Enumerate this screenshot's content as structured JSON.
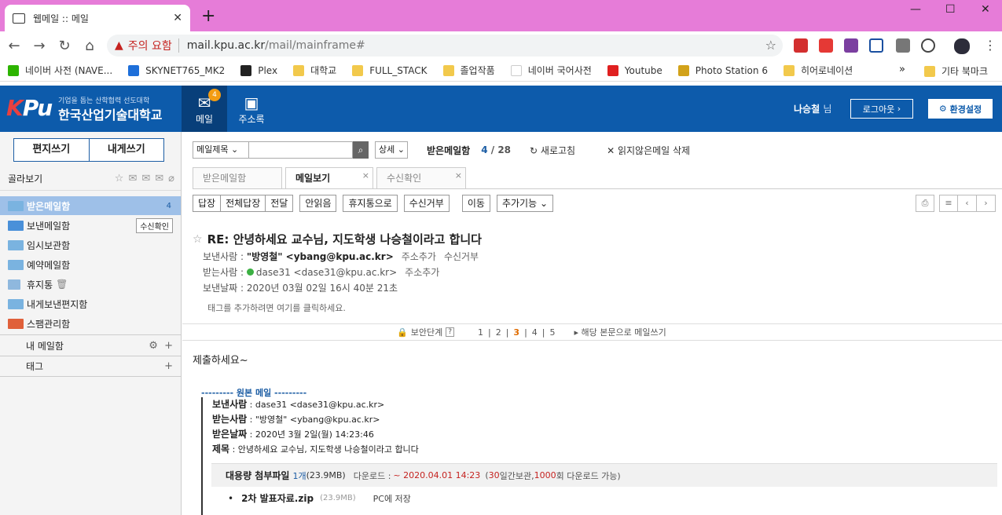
{
  "browser": {
    "tab_title": "웹메일 :: 메일",
    "warning_text": "주의 요함",
    "url_host": "mail.kpu.ac.kr",
    "url_path": "/mail/mainframe#",
    "bookmarks": [
      "네이버 사전 (NAVE...",
      "SKYNET765_MK2",
      "Plex",
      "대학교",
      "FULL_STACK",
      "졸업작품",
      "네이버 국어사전",
      "Youtube",
      "Photo Station 6",
      "히어로네이션"
    ],
    "other_bookmarks": "기타 북마크"
  },
  "app": {
    "logo_text": "KPU",
    "logo_subtitle": "기업을 돕는 산학협력 선도대학",
    "logo_name": "한국산업기술대학교",
    "menu_mail": "메일",
    "menu_mail_badge": "4",
    "menu_address": "주소록",
    "user_name": "나승철",
    "user_suffix": "님",
    "logout": "로그아웃",
    "settings": "환경설정"
  },
  "sidebar": {
    "write": "편지쓰기",
    "write_self": "내게쓰기",
    "filter_label": "골라보기",
    "folders": [
      {
        "name": "받은메일함",
        "count": "4"
      },
      {
        "name": "보낸메일함",
        "button": "수신확인"
      },
      {
        "name": "임시보관함"
      },
      {
        "name": "예약메일함"
      },
      {
        "name": "휴지통"
      },
      {
        "name": "내게보낸편지함"
      },
      {
        "name": "스팸관리함"
      }
    ],
    "my_mailbox": "내 메일함",
    "tags": "태그"
  },
  "search": {
    "field": "메일제목",
    "detail": "상세",
    "box_name": "받은메일함",
    "current": "4",
    "total": "28",
    "refresh": "새로고침",
    "delete_unread": "읽지않은메일 삭제"
  },
  "tabs": [
    "받은메일함",
    "메일보기",
    "수신확인"
  ],
  "toolbar": [
    "답장",
    "전체답장",
    "전달",
    "안읽음",
    "휴지통으로",
    "수신거부",
    "이동",
    "추가기능"
  ],
  "message": {
    "subject": "RE: 안녕하세요 교수님, 지도학생 나승철이라고 합니다",
    "from_label": "보낸사람 :",
    "from_value": "\"방영철\" <ybang@kpu.ac.kr>",
    "add_contact": "주소추가",
    "block": "수신거부",
    "to_label": "받는사람 :",
    "to_value": "dase31 <dase31@kpu.ac.kr>",
    "date_label": "보낸날짜 :",
    "date_value": "2020년 03월 02일 16시 40분 21초",
    "tag_hint": "태그를 추가하려면 여기를 클릭하세요.",
    "security_label": "보안단계",
    "security_levels": [
      "1",
      "2",
      "3",
      "4",
      "5"
    ],
    "reply_with_body": "해당 본문으로 메일쓰기",
    "body": "제출하세요~",
    "original_header": "--------- 원본 메일 ---------",
    "orig_from_label": "보낸사람",
    "orig_from": ": dase31 <dase31@kpu.ac.kr>",
    "orig_to_label": "받는사람",
    "orig_to": ": \"방영철\" <ybang@kpu.ac.kr>",
    "orig_date_label": "받은날짜",
    "orig_date": ": 2020년 3월 2일(월) 14:23:46",
    "orig_subject_label": "제목",
    "orig_subject": ": 안녕하세요 교수님, 지도학생 나승철이라고 합니다",
    "attach_title": "대용량 첨부파일",
    "attach_count": "1개",
    "attach_size": "(23.9MB)",
    "download_label": "다운로드 :",
    "download_until": "~ 2020.04.01 14:23",
    "keep_open": "(",
    "keep_days": "30",
    "keep_mid": "일간보관,",
    "keep_count": "1000",
    "keep_close": "회 다운로드 가능)",
    "file_name": "2차 발표자료.zip",
    "file_size": "(23.9MB)",
    "save_pc": "PC에 저장"
  }
}
